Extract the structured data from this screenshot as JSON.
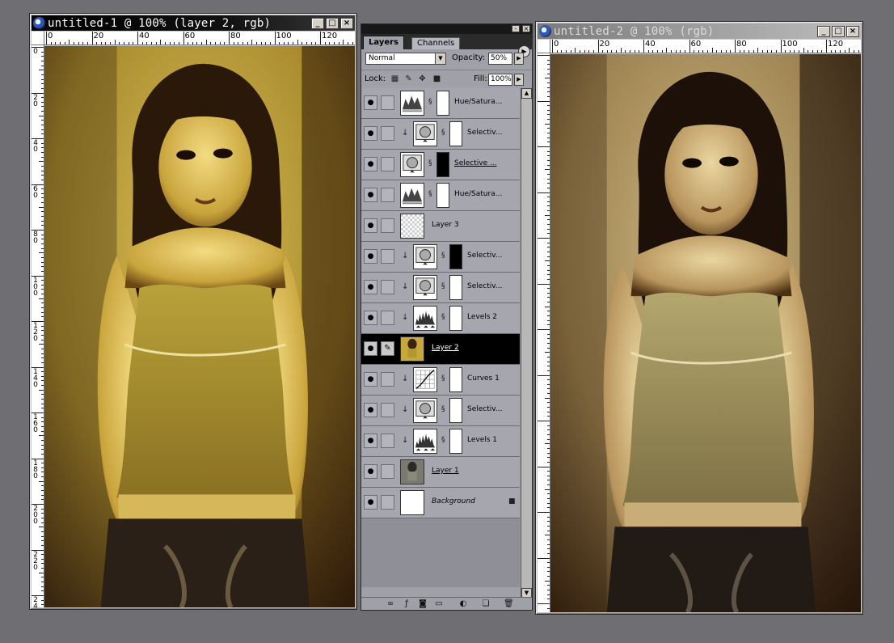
{
  "windows": [
    {
      "title": "untitled-1 @ 100% (layer 2, rgb)",
      "buttons": [
        "_",
        "□",
        "×"
      ]
    },
    {
      "title": "untitled-2 @ 100% (rgb)",
      "buttons": [
        "_",
        "□",
        "×"
      ]
    }
  ],
  "ruler": {
    "top_labels": [
      "0",
      "20",
      "40",
      "60",
      "80",
      "100",
      "120"
    ],
    "left_labels": [
      "0",
      "20",
      "40",
      "60",
      "80",
      "100",
      "120",
      "140",
      "160",
      "180",
      "200",
      "220",
      "24"
    ]
  },
  "layers_panel": {
    "tabs": [
      {
        "label": "Layers",
        "active": true
      },
      {
        "label": "Channels",
        "active": false
      }
    ],
    "blend_mode": "Normal",
    "opacity_label": "Opacity:",
    "opacity_value": "50%",
    "lock_label": "Lock:",
    "fill_label": "Fill:",
    "fill_value": "100%",
    "layers": [
      {
        "name": "Hue/Satura...",
        "thumb": "hue",
        "mask": "white",
        "clipped": false,
        "selected": false
      },
      {
        "name": "Selectiv...",
        "thumb": "selective",
        "mask": "white",
        "clipped": true,
        "selected": false
      },
      {
        "name": "Selective ...",
        "thumb": "selective",
        "mask": "dark",
        "clipped": false,
        "selected": false,
        "underline": true
      },
      {
        "name": "Hue/Satura...",
        "thumb": "hue",
        "mask": "white",
        "clipped": false,
        "selected": false
      },
      {
        "name": "Layer 3",
        "thumb": "transparent",
        "mask": "none",
        "clipped": false,
        "selected": false
      },
      {
        "name": "Selectiv...",
        "thumb": "selective",
        "mask": "dark",
        "clipped": true,
        "selected": false
      },
      {
        "name": "Selectiv...",
        "thumb": "selective",
        "mask": "white",
        "clipped": true,
        "selected": false
      },
      {
        "name": "Levels 2",
        "thumb": "levels",
        "mask": "white",
        "clipped": true,
        "selected": false
      },
      {
        "name": "Layer 2",
        "thumb": "photo-yellow",
        "mask": "none",
        "clipped": false,
        "selected": true,
        "underline": true
      },
      {
        "name": "Curves 1",
        "thumb": "curves",
        "mask": "white",
        "clipped": true,
        "selected": false
      },
      {
        "name": "Selectiv...",
        "thumb": "selective",
        "mask": "white",
        "clipped": true,
        "selected": false
      },
      {
        "name": "Levels 1",
        "thumb": "levels",
        "mask": "white",
        "clipped": true,
        "selected": false
      },
      {
        "name": "Layer 1",
        "thumb": "photo-gray",
        "mask": "none",
        "clipped": false,
        "selected": false,
        "underline": true
      },
      {
        "name": "Background",
        "thumb": "white",
        "mask": "none",
        "clipped": false,
        "selected": false,
        "italic": true,
        "locked": true
      }
    ],
    "bottom_icons": [
      "link-layers-icon",
      "layer-style-icon",
      "layer-mask-icon",
      "new-set-icon",
      "adjustment-layer-icon",
      "new-layer-icon",
      "trash-icon"
    ]
  },
  "colors": {
    "left_tone_light": "#c8b04a",
    "left_tone_dark": "#2a1608",
    "right_tone_light": "#b9aa70",
    "right_tone_dark": "#1a0e06"
  }
}
